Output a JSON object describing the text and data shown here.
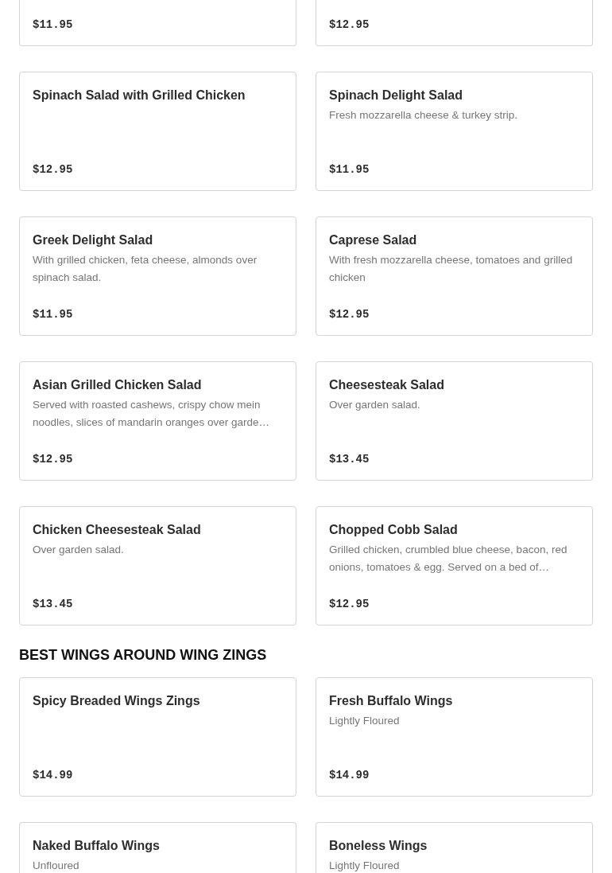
{
  "sections": [
    {
      "items": [
        {
          "price": "$11.95"
        },
        {
          "price": "$12.95"
        },
        {
          "name": "Spinach Salad with Grilled Chicken",
          "price": "$12.95"
        },
        {
          "name": "Spinach Delight Salad",
          "description": "Fresh mozzarella cheese & turkey strip.",
          "price": "$11.95"
        },
        {
          "name": "Greek Delight Salad",
          "description": "With grilled chicken, feta cheese, almonds over spinach salad.",
          "price": "$11.95"
        },
        {
          "name": "Caprese Salad",
          "description": "With fresh mozzarella cheese, tomatoes and grilled chicken",
          "price": "$12.95"
        },
        {
          "name": "Asian Grilled Chicken Salad",
          "description": "Served with roasted cashews, crispy chow mein noodles, slices of mandarin oranges over garde…",
          "price": "$12.95"
        },
        {
          "name": "Cheesesteak Salad",
          "description": "Over garden salad.",
          "price": "$13.45"
        },
        {
          "name": "Chicken Cheesesteak Salad",
          "description": "Over garden salad.",
          "price": "$13.45"
        },
        {
          "name": "Chopped Cobb Salad",
          "description": "Grilled chicken, crumbled blue cheese, bacon, red onions, tomatoes & egg. Served on a bed of…",
          "price": "$12.95"
        }
      ]
    },
    {
      "title": "BEST WINGS AROUND WING ZINGS",
      "items": [
        {
          "name": "Spicy Breaded Wings Zings",
          "price": "$14.99"
        },
        {
          "name": "Fresh Buffalo Wings",
          "description": "Lightly Floured",
          "price": "$14.99"
        },
        {
          "name": "Naked Buffalo Wings",
          "description": "Unfloured"
        },
        {
          "name": "Boneless Wings",
          "description": "Lightly Floured"
        }
      ]
    }
  ]
}
